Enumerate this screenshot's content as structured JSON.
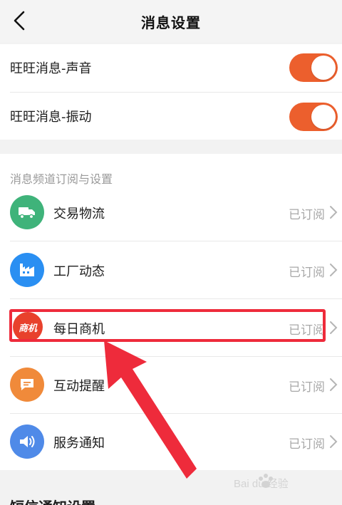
{
  "header": {
    "title": "消息设置",
    "back_icon": "chevron-left-icon"
  },
  "sound_settings": {
    "items": [
      {
        "label": "旺旺消息-声音",
        "enabled": true
      },
      {
        "label": "旺旺消息-振动",
        "enabled": true
      }
    ],
    "toggle_on_color": "#ec5f2d"
  },
  "channels": {
    "section_title": "消息频道订阅与设置",
    "items": [
      {
        "label": "交易物流",
        "status": "已订阅",
        "icon": "truck-icon",
        "color": "#3fb37a"
      },
      {
        "label": "工厂动态",
        "status": "已订阅",
        "icon": "factory-icon",
        "color": "#2a8ff2"
      },
      {
        "label": "每日商机",
        "status": "已订阅",
        "icon": "business-opportunity-icon",
        "icon_text": "商机",
        "color": "#e8412c"
      },
      {
        "label": "互动提醒",
        "status": "已订阅",
        "icon": "chat-icon",
        "color": "#f08a3a"
      },
      {
        "label": "服务通知",
        "status": "已订阅",
        "icon": "speaker-icon",
        "color": "#4f8ae8"
      }
    ]
  },
  "bottom_section": {
    "title": "短信通知设置"
  },
  "annotation": {
    "highlight_color": "#ee2b3b"
  },
  "watermark": {
    "text": "Bai du 经验"
  }
}
